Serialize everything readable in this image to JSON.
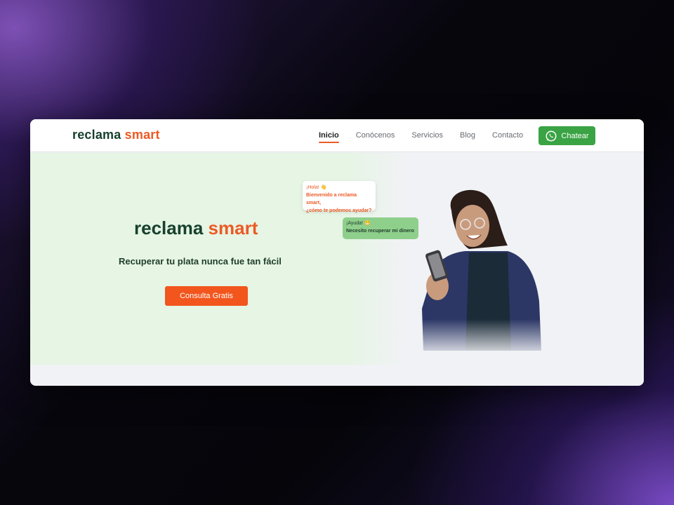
{
  "brand": {
    "word1": "reclama",
    "word2": "smar",
    "cross": "t"
  },
  "nav": {
    "items": [
      {
        "label": "Inicio",
        "active": true
      },
      {
        "label": "Conócenos",
        "active": false
      },
      {
        "label": "Servicios",
        "active": false
      },
      {
        "label": "Blog",
        "active": false
      },
      {
        "label": "Contacto",
        "active": false
      }
    ],
    "chat_button": "Chatear"
  },
  "hero": {
    "tagline": "Recuperar tu plata nunca fue tan fácil",
    "cta_label": "Consulta Gratis"
  },
  "chat_bubbles": {
    "greeting": {
      "hello": "¡Hola! 👋",
      "line1": "Bienvenido a reclama smart,",
      "line2": "¿cómo te podemos ayudar?"
    },
    "reply": {
      "help": "¡Ayuda! 😁",
      "line1": "Necesito recuperar mi dinero"
    }
  },
  "colors": {
    "brand_green": "#17412d",
    "brand_orange": "#ec5a24",
    "whatsapp_green": "#3aa344",
    "hero_bg": "#e6f5e4"
  },
  "icons": {
    "chat": "whatsapp-icon"
  }
}
